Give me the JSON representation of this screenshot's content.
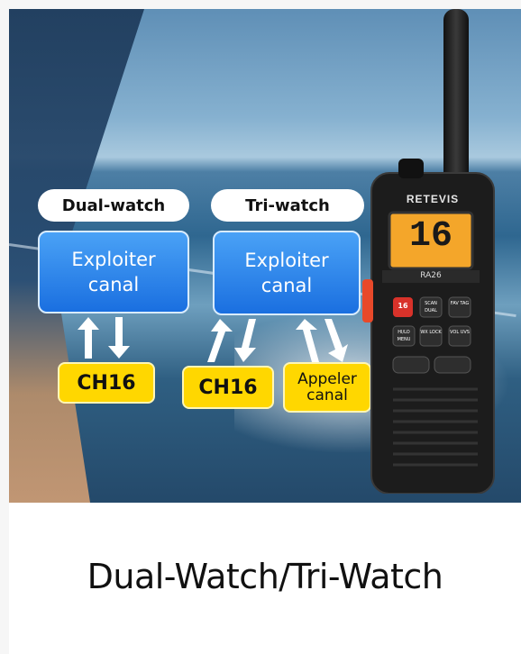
{
  "hero": {
    "dual_watch": {
      "heading": "Dual-watch",
      "box_line1": "Exploiter",
      "box_line2": "canal",
      "channel": "CH16"
    },
    "tri_watch": {
      "heading": "Tri-watch",
      "box_line1": "Exploiter",
      "box_line2": "canal",
      "channel": "CH16",
      "call_line1": "Appeler",
      "call_line2": "canal"
    },
    "radio": {
      "brand": "RETEVIS",
      "model": "RA26",
      "display_number": "16",
      "keys": [
        "16",
        "SCAN DUAL",
        "FAV TAG",
        "HI/LO MENU",
        "WX LOCK",
        "VOL UVS"
      ]
    }
  },
  "caption": "Dual-Watch/Tri-Watch",
  "colors": {
    "box_blue": "#2a82ea",
    "channel_yellow": "#ffd700",
    "radio_body": "#1c1c1c",
    "lcd_orange": "#f4a62a"
  }
}
